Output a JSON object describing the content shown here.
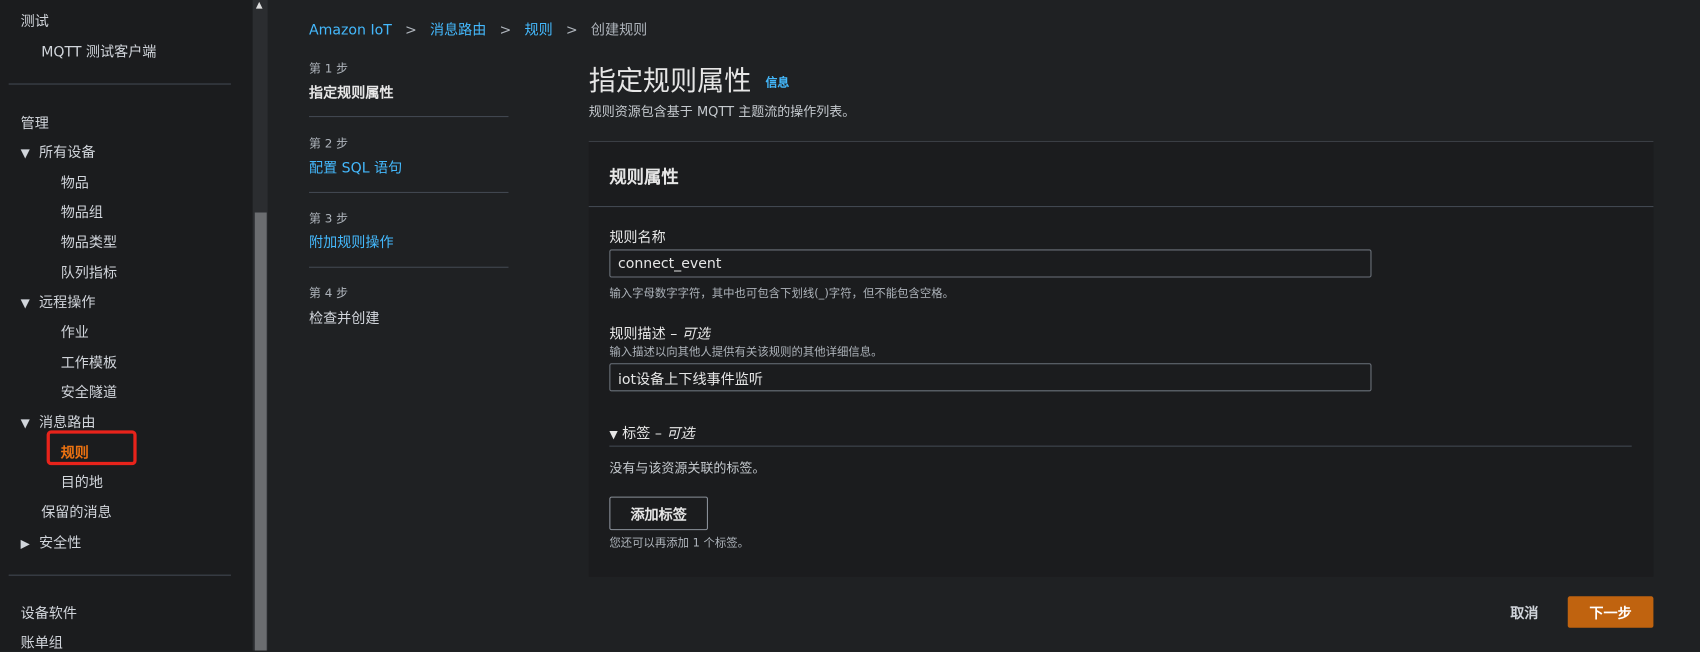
{
  "sidebar": {
    "test_header": "测试",
    "mqtt_client": "MQTT 测试客户端",
    "manage_header": "管理",
    "all_devices": "所有设备",
    "things": "物品",
    "thing_groups": "物品组",
    "thing_types": "物品类型",
    "fleet_metrics": "队列指标",
    "remote_ops": "远程操作",
    "jobs": "作业",
    "job_templates": "工作模板",
    "secure_tunnels": "安全隧道",
    "message_routing": "消息路由",
    "rules": "规则",
    "destinations": "目的地",
    "retained_messages": "保留的消息",
    "security": "安全性",
    "device_software": "设备软件",
    "billing_groups": "账单组",
    "active_color": "#ec7211",
    "highlight_color": "#e8231b"
  },
  "breadcrumb": [
    "Amazon IoT",
    "消息路由",
    "规则",
    "创建规则"
  ],
  "steps": [
    {
      "label": "第 1 步",
      "title": "指定规则属性"
    },
    {
      "label": "第 2 步",
      "title": "配置 SQL 语句"
    },
    {
      "label": "第 3 步",
      "title": "附加规则操作"
    },
    {
      "label": "第 4 步",
      "title": "检查并创建"
    }
  ],
  "page": {
    "title": "指定规则属性",
    "info_link": "信息",
    "description": "规则资源包含基于 MQTT 主题流的操作列表。"
  },
  "panel": {
    "title": "规则属性",
    "name_label": "规则名称",
    "name_value": "connect_event",
    "name_hint": "输入字母数字字符，其中也可包含下划线(_)字符，但不能包含空格。",
    "desc_label": "规则描述",
    "optional": "可选",
    "desc_hint": "输入描述以向其他人提供有关该规则的其他详细信息。",
    "desc_value": "iot设备上下线事件监听",
    "tags_label": "标签",
    "no_tags": "没有与该资源关联的标签。",
    "add_tag": "添加标签",
    "tags_remaining": "您还可以再添加 1 个标签。"
  },
  "footer": {
    "cancel": "取消",
    "next": "下一步",
    "accent": "#ec7211"
  }
}
